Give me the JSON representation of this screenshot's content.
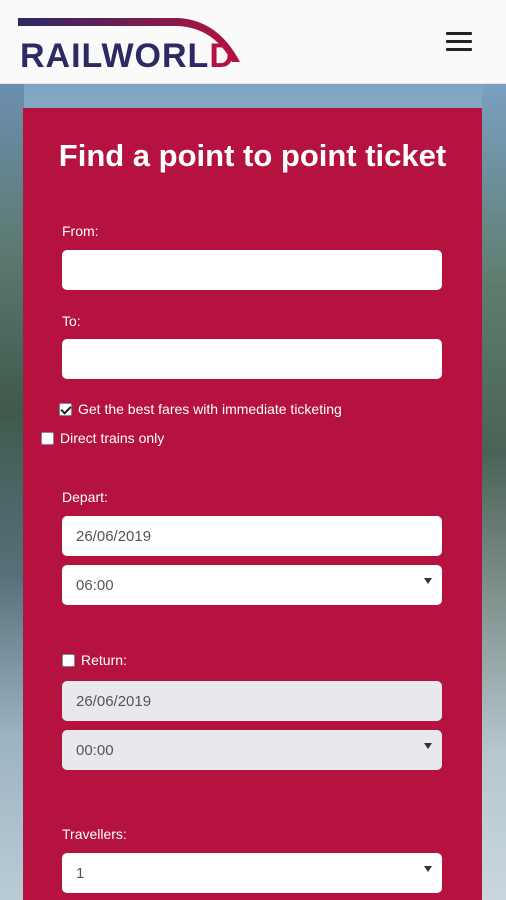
{
  "brand": {
    "logo_main": "RAILWORL",
    "logo_accent": "D",
    "colors": {
      "primary": "#b5123f",
      "navy": "#2b2a63"
    }
  },
  "header": {
    "menu_icon": "hamburger-menu-icon"
  },
  "form": {
    "title": "Find a point to point ticket",
    "from_label": "From:",
    "from_value": "",
    "to_label": "To:",
    "to_value": "",
    "best_fares_label": "Get the best fares with immediate ticketing",
    "best_fares_checked": true,
    "direct_label": "Direct trains only",
    "direct_checked": false,
    "depart_label": "Depart:",
    "depart_date": "26/06/2019",
    "depart_time": "06:00",
    "return_label": "Return:",
    "return_checked": false,
    "return_date": "26/06/2019",
    "return_time": "00:00",
    "travellers_label": "Travellers:",
    "travellers_value": "1"
  }
}
